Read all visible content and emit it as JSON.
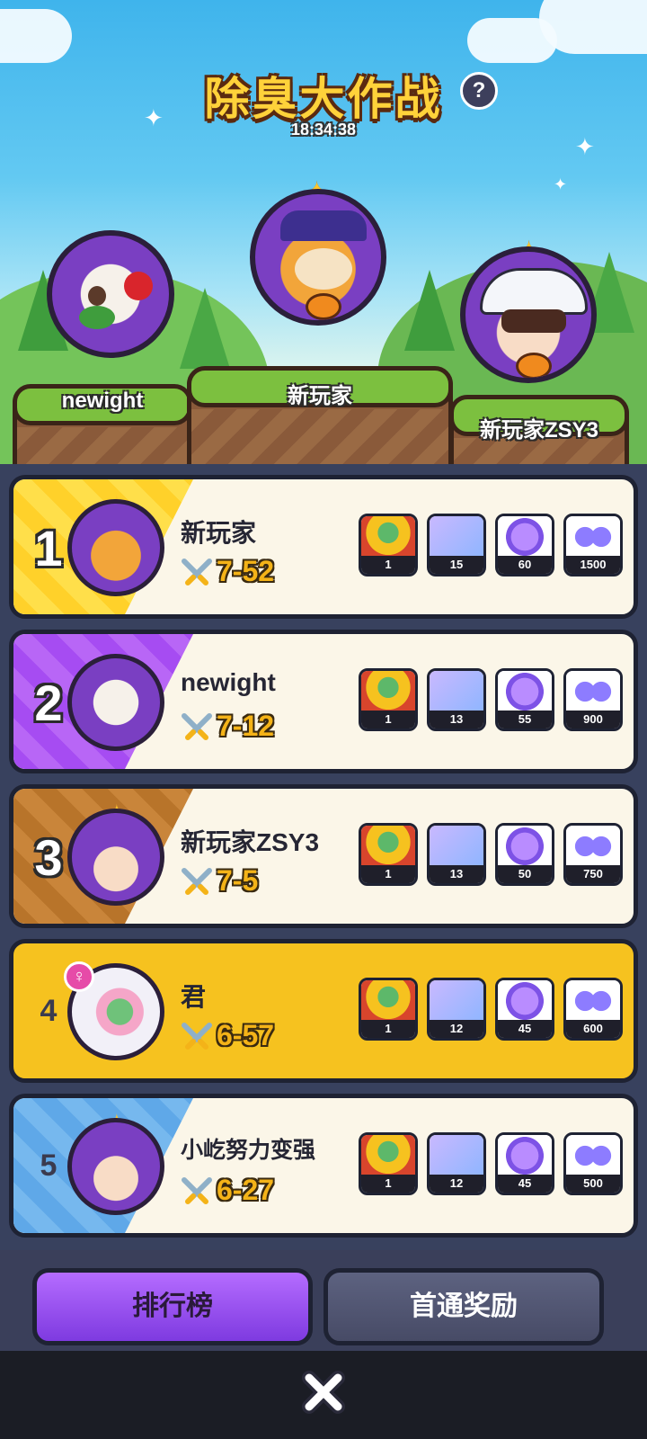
{
  "header": {
    "title": "除臭大作战",
    "help_label": "?",
    "timer": "18:34:38"
  },
  "podium": [
    {
      "place": 2,
      "name": "newight"
    },
    {
      "place": 1,
      "name": "新玩家"
    },
    {
      "place": 3,
      "name": "新玩家ZSY3"
    }
  ],
  "ranking": [
    {
      "rank": "1",
      "name": "新玩家",
      "score": "7-52",
      "rewards": [
        "1",
        "15",
        "60",
        "1500"
      ]
    },
    {
      "rank": "2",
      "name": "newight",
      "score": "7-12",
      "rewards": [
        "1",
        "13",
        "55",
        "900"
      ]
    },
    {
      "rank": "3",
      "name": "新玩家ZSY3",
      "score": "7-5",
      "rewards": [
        "1",
        "13",
        "50",
        "750"
      ]
    },
    {
      "rank": "4",
      "name": "君",
      "score": "6-57",
      "rewards": [
        "1",
        "12",
        "45",
        "600"
      ],
      "gender_icon": "♀",
      "is_self": true
    },
    {
      "rank": "5",
      "name": "小屹努力变强",
      "score": "6-27",
      "rewards": [
        "1",
        "12",
        "45",
        "500"
      ]
    }
  ],
  "reward_icons": [
    "statue-reward-icon",
    "mystery-box-icon",
    "capsule-icon",
    "star-coins-icon"
  ],
  "tabs": {
    "leaderboard": "排行榜",
    "first_clear": "首通奖励"
  },
  "colors": {
    "gold": "#f6c21f",
    "purple": "#9b4bf0",
    "bronze": "#b8742a",
    "blue": "#5fa8e8"
  }
}
